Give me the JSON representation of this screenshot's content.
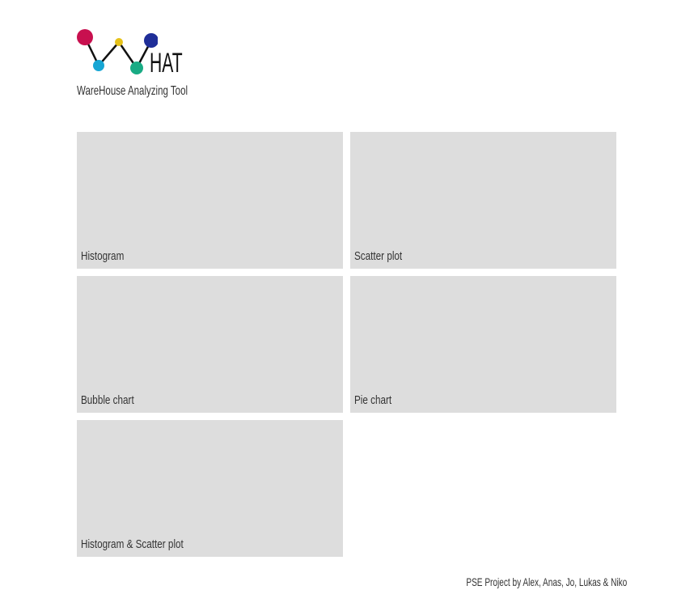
{
  "header": {
    "logo_word": "HAT",
    "tagline": "WareHouse Analyzing Tool",
    "logo_colors": {
      "pink": "#c8104f",
      "cyan": "#17a6d4",
      "yellow": "#e6c21a",
      "green": "#19ab84",
      "blue": "#1f2e98"
    }
  },
  "tiles": [
    {
      "label": "Histogram"
    },
    {
      "label": "Scatter plot"
    },
    {
      "label": "Bubble chart"
    },
    {
      "label": "Pie chart"
    },
    {
      "label": "Histogram & Scatter plot"
    }
  ],
  "footer": {
    "credits": "PSE Project by Alex, Anas, Jo, Lukas & Niko"
  }
}
